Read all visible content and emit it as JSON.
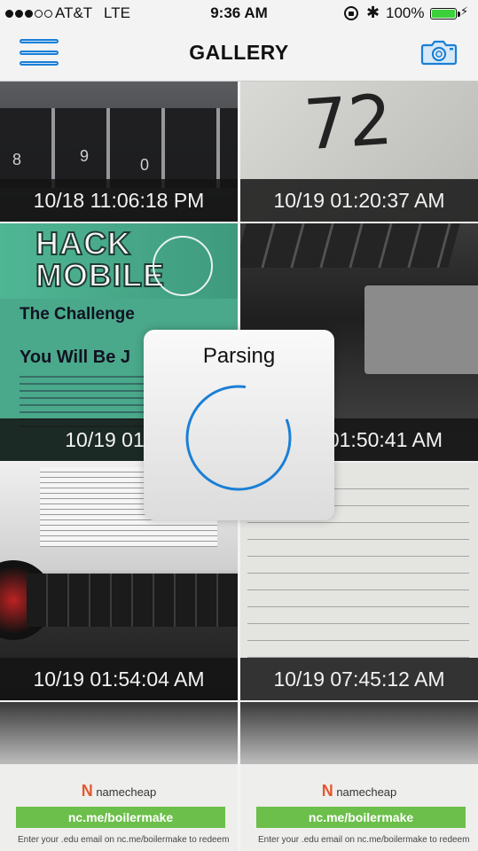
{
  "status_bar": {
    "carrier": "AT&T",
    "network": "LTE",
    "time": "9:36 AM",
    "battery_percent": "100%",
    "signal_bars_filled": 3,
    "signal_bars_total": 5,
    "battery_level": 1.0,
    "battery_color": "#3ad13a"
  },
  "nav_bar": {
    "title": "GALLERY",
    "menu_icon": "hamburger-menu-icon",
    "camera_icon": "camera-icon",
    "accent_color": "#1a7fd6"
  },
  "gallery": {
    "items": [
      {
        "timestamp": "10/18 11:06:18 PM"
      },
      {
        "timestamp": "10/19 01:20:37 AM"
      },
      {
        "timestamp": "10/19 01:22"
      },
      {
        "timestamp": "01:50:41 AM"
      },
      {
        "timestamp": "10/19 01:54:04 AM"
      },
      {
        "timestamp": "10/19 07:45:12 AM"
      },
      {
        "timestamp": ""
      },
      {
        "timestamp": ""
      }
    ],
    "photo_text": {
      "keyboard_keys": [
        "8",
        "9",
        "0"
      ],
      "paper_number": "72",
      "hack_title": "HACK MOBILE",
      "hack_challenge": "The Challenge",
      "hack_sub": "You Will Be J",
      "card_brand": "namecheap",
      "card_url": "nc.me/boilermake",
      "card_fine_print": "Enter your .edu email on nc.me/boilermake to redeem"
    }
  },
  "loader": {
    "title": "Parsing",
    "spinner_color": "#1a7fd6"
  }
}
